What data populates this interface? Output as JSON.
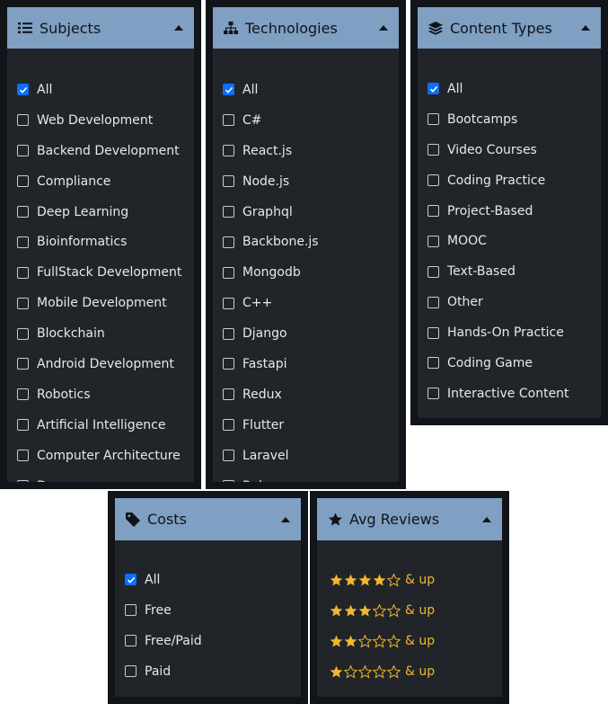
{
  "colors": {
    "header_bg": "#7f9fc3",
    "panel_bg": "#212529",
    "frame": "#111418",
    "checkbox_on": "#0d6efd",
    "star": "#f0b72f"
  },
  "subjects": {
    "title": "Subjects",
    "icon": "list-icon",
    "items": [
      {
        "label": "All",
        "checked": true
      },
      {
        "label": "Web Development",
        "checked": false
      },
      {
        "label": "Backend Development",
        "checked": false
      },
      {
        "label": "Compliance",
        "checked": false
      },
      {
        "label": "Deep Learning",
        "checked": false
      },
      {
        "label": "Bioinformatics",
        "checked": false
      },
      {
        "label": "FullStack Development",
        "checked": false
      },
      {
        "label": "Mobile Development",
        "checked": false
      },
      {
        "label": "Blockchain",
        "checked": false
      },
      {
        "label": "Android Development",
        "checked": false
      },
      {
        "label": "Robotics",
        "checked": false
      },
      {
        "label": "Artificial Intelligence",
        "checked": false
      },
      {
        "label": "Computer Architecture",
        "checked": false
      },
      {
        "label": "Devops",
        "checked": false
      }
    ]
  },
  "technologies": {
    "title": "Technologies",
    "icon": "sitemap-icon",
    "items": [
      {
        "label": "All",
        "checked": true
      },
      {
        "label": "C#",
        "checked": false
      },
      {
        "label": "React.js",
        "checked": false
      },
      {
        "label": "Node.js",
        "checked": false
      },
      {
        "label": "Graphql",
        "checked": false
      },
      {
        "label": "Backbone.js",
        "checked": false
      },
      {
        "label": "Mongodb",
        "checked": false
      },
      {
        "label": "C++",
        "checked": false
      },
      {
        "label": "Django",
        "checked": false
      },
      {
        "label": "Fastapi",
        "checked": false
      },
      {
        "label": "Redux",
        "checked": false
      },
      {
        "label": "Flutter",
        "checked": false
      },
      {
        "label": "Laravel",
        "checked": false
      },
      {
        "label": "Ruby",
        "checked": false
      }
    ]
  },
  "content_types": {
    "title": "Content Types",
    "icon": "layers-icon",
    "items": [
      {
        "label": "All",
        "checked": true
      },
      {
        "label": "Bootcamps",
        "checked": false
      },
      {
        "label": "Video Courses",
        "checked": false
      },
      {
        "label": "Coding Practice",
        "checked": false
      },
      {
        "label": "Project-Based",
        "checked": false
      },
      {
        "label": "MOOC",
        "checked": false
      },
      {
        "label": "Text-Based",
        "checked": false
      },
      {
        "label": "Other",
        "checked": false
      },
      {
        "label": "Hands-On Practice",
        "checked": false
      },
      {
        "label": "Coding Game",
        "checked": false
      },
      {
        "label": "Interactive Content",
        "checked": false
      }
    ]
  },
  "costs": {
    "title": "Costs",
    "icon": "tag-icon",
    "items": [
      {
        "label": "All",
        "checked": true
      },
      {
        "label": "Free",
        "checked": false
      },
      {
        "label": "Free/Paid",
        "checked": false
      },
      {
        "label": "Paid",
        "checked": false
      }
    ]
  },
  "reviews": {
    "title": "Avg Reviews",
    "icon": "star-icon",
    "items": [
      {
        "stars": 4,
        "of": 5,
        "suffix": "& up"
      },
      {
        "stars": 3,
        "of": 5,
        "suffix": "& up"
      },
      {
        "stars": 2,
        "of": 5,
        "suffix": "& up"
      },
      {
        "stars": 1,
        "of": 5,
        "suffix": "& up"
      }
    ]
  }
}
